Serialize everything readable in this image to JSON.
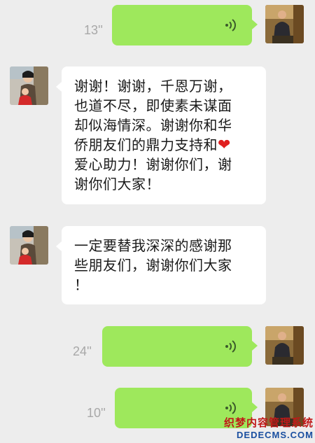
{
  "colors": {
    "background": "#ededed",
    "outgoing_bubble": "#9ee85c",
    "incoming_bubble": "#ffffff",
    "duration_text": "#a8a8a8"
  },
  "messages": [
    {
      "direction": "outgoing",
      "type": "voice",
      "duration": "13''"
    },
    {
      "direction": "incoming",
      "type": "text",
      "lines": [
        "谢谢！谢谢，千恩万谢，",
        "也道不尽，即使素未谋面",
        "却似海情深。谢谢你和华",
        "侨朋友们的鼎力支持和",
        "爱心助力！谢谢你们，谢",
        "谢你们大家！"
      ],
      "emoji": "red-heart"
    },
    {
      "direction": "incoming",
      "type": "text",
      "lines": [
        "一定要替我深深的感谢那",
        "些朋友们，谢谢你们大家",
        "！"
      ]
    },
    {
      "direction": "outgoing",
      "type": "voice",
      "duration": "24''"
    },
    {
      "direction": "outgoing",
      "type": "voice",
      "duration": "10''"
    }
  ],
  "icons": {
    "voice": "voice-wave-icon",
    "avatar_self": "man-portrait-avatar",
    "avatar_other": "woman-child-portrait-avatar"
  },
  "watermark": {
    "cn": "织梦内容管理系统",
    "en": "DEDECMS.COM"
  }
}
